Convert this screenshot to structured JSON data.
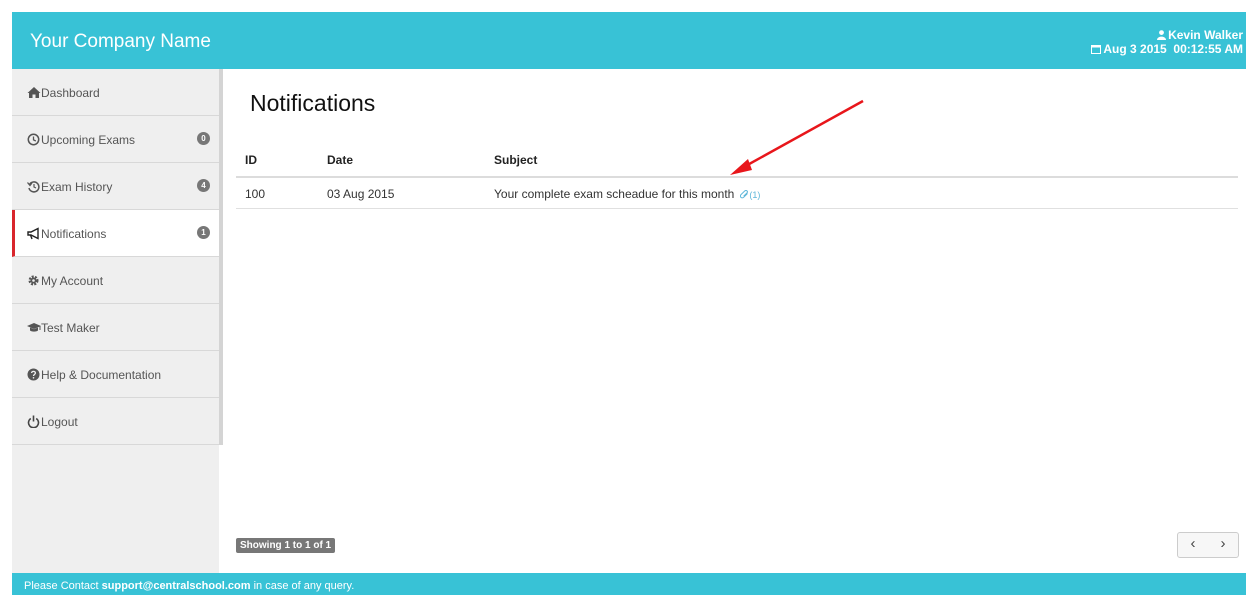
{
  "header": {
    "company_name": "Your Company Name",
    "user_name": "Kevin Walker",
    "date": "Aug 3 2015",
    "time": "00:12:55 AM"
  },
  "sidebar": {
    "items": [
      {
        "label": "Dashboard",
        "icon": "home-icon"
      },
      {
        "label": "Upcoming Exams",
        "icon": "clock-icon",
        "badge": "0"
      },
      {
        "label": "Exam History",
        "icon": "history-icon",
        "badge": "4"
      },
      {
        "label": "Notifications",
        "icon": "megaphone-icon",
        "badge": "1",
        "active": true
      },
      {
        "label": "My Account",
        "icon": "gear-icon"
      },
      {
        "label": "Test Maker",
        "icon": "graduation-cap-icon"
      },
      {
        "label": "Help & Documentation",
        "icon": "question-circle-icon"
      },
      {
        "label": "Logout",
        "icon": "power-icon"
      }
    ]
  },
  "main": {
    "title": "Notifications",
    "table": {
      "columns": [
        "ID",
        "Date",
        "Subject"
      ],
      "rows": [
        {
          "id": "100",
          "date": "03 Aug 2015",
          "subject": "Your complete exam scheadue for this month",
          "attachments": "(1)"
        }
      ]
    },
    "showing": "Showing 1 to 1 of 1",
    "pager": {
      "prev": "‹",
      "next": "›"
    }
  },
  "footer": {
    "prefix": "Please Contact ",
    "email": "support@centralschool.com",
    "suffix": " in case of any query."
  },
  "colors": {
    "header_bg": "#38c2d6",
    "active_indicator": "#d9262c",
    "annotation_arrow": "#e8161b"
  }
}
